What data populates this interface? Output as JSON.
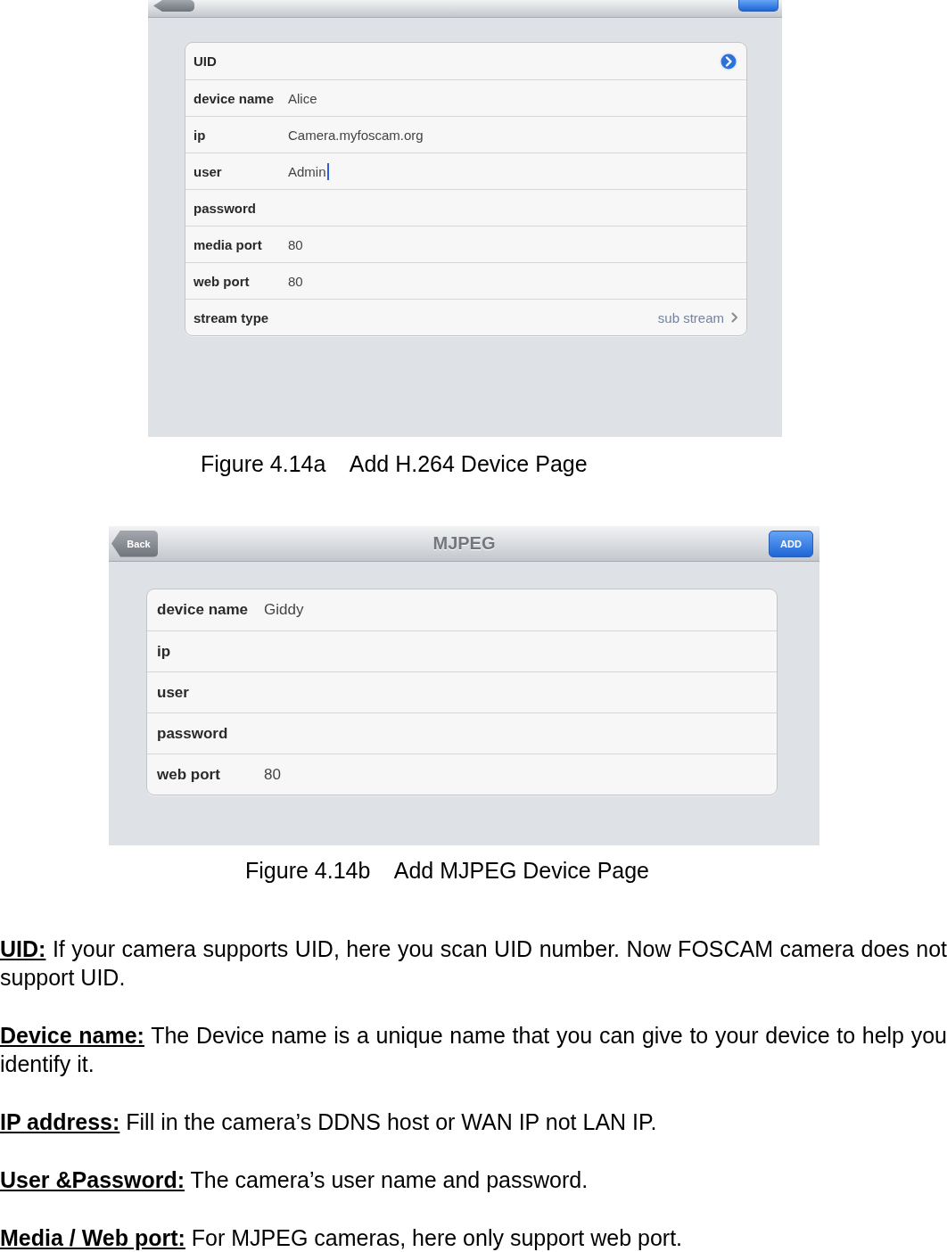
{
  "figures": [
    {
      "nav": {
        "clipped": true
      },
      "form": {
        "rows": [
          {
            "kind": "detail",
            "label": "UID"
          },
          {
            "kind": "field",
            "label": "device name",
            "value": "Alice",
            "focused": false
          },
          {
            "kind": "field",
            "label": "ip",
            "value": "Camera.myfoscam.org",
            "focused": false
          },
          {
            "kind": "field",
            "label": "user",
            "value": "Admin",
            "focused": true
          },
          {
            "kind": "field",
            "label": "password",
            "focused": false
          },
          {
            "kind": "field",
            "label": "media port",
            "value": "80",
            "focused": false
          },
          {
            "kind": "field",
            "label": "web port",
            "value": "80",
            "focused": false
          },
          {
            "kind": "picker",
            "label": "stream type",
            "value": "sub stream"
          }
        ]
      },
      "caption": "Figure 4.14a    Add H.264 Device Page"
    },
    {
      "nav": {
        "clipped": false,
        "back": "Back",
        "title": "MJPEG",
        "add": "ADD"
      },
      "form": {
        "rows": [
          {
            "kind": "field",
            "label": "device name",
            "value": "Giddy",
            "focused": false
          },
          {
            "kind": "field",
            "label": "ip",
            "focused": false
          },
          {
            "kind": "field",
            "label": "user",
            "focused": false
          },
          {
            "kind": "field",
            "label": "password",
            "focused": false
          },
          {
            "kind": "field",
            "label": "web port",
            "value": "80",
            "focused": false
          }
        ]
      },
      "caption": "Figure 4.14b    Add MJPEG Device Page"
    }
  ],
  "paragraphs": [
    "**UID:** If your camera supports UID, here you scan UID number. Now FOSCAM camera does not support UID.",
    "**Device name:** The Device name is a unique name that you can give to your device to help you identify it.",
    "**IP address:** Fill in the camera’s DDNS host or WAN IP not LAN IP.",
    "**User &Password:** The camera’s user name and password.",
    "**Media / Web port:** For MJPEG cameras, here only support web port."
  ]
}
